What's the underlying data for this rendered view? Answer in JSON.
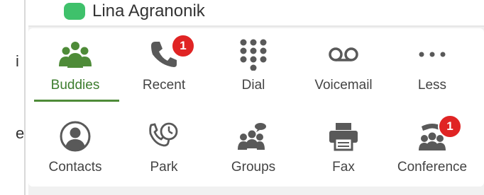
{
  "contact": {
    "name": "Lina Agranonik",
    "status": "available"
  },
  "left_fragments": [
    "i",
    "e"
  ],
  "tabs": [
    {
      "label": "Buddies",
      "icon": "buddies-icon",
      "active": true
    },
    {
      "label": "Recent",
      "icon": "phone-icon",
      "badge": "1"
    },
    {
      "label": "Dial",
      "icon": "dialpad-icon"
    },
    {
      "label": "Voicemail",
      "icon": "voicemail-icon"
    },
    {
      "label": "Less",
      "icon": "more-dots-icon"
    },
    {
      "label": "Contacts",
      "icon": "contacts-icon"
    },
    {
      "label": "Park",
      "icon": "park-icon"
    },
    {
      "label": "Groups",
      "icon": "groups-icon"
    },
    {
      "label": "Fax",
      "icon": "fax-icon"
    },
    {
      "label": "Conference",
      "icon": "conference-icon",
      "badge": "1"
    }
  ],
  "colors": {
    "accent": "#4e8b38",
    "icon": "#595959",
    "badge": "#e02424",
    "status_available": "#3fc16b"
  }
}
